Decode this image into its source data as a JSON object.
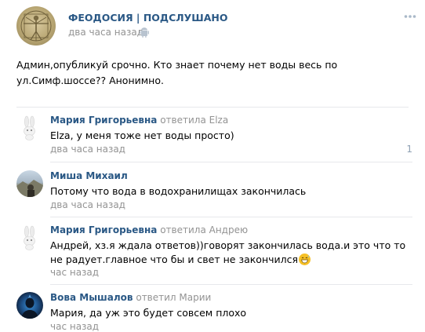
{
  "post": {
    "group_name": "ФЕОДОСИЯ | ПОДСЛУШАНО",
    "time": "два часа назад",
    "text": "Админ,опубликуй срочно. Кто знает почему нет воды весь по ул.Симф.шоссе?? Анонимно."
  },
  "comments": [
    {
      "author": "Мария Григорьевна",
      "reply_to": " ответила Elza",
      "text": "Elza, у меня тоже нет воды просто)",
      "time": "два часа назад",
      "likes": "1"
    },
    {
      "author": "Миша Михаил",
      "reply_to": "",
      "text": "Потому что вода в водохранилищах закончилась",
      "time": "два часа назад"
    },
    {
      "author": "Мария Григорьевна",
      "reply_to": " ответила Андрею",
      "text": "Андрей, хз.я ждала ответов))говорят закончилась вода.и это что то не радует.главное что бы и свет не закончился",
      "time": "час назад"
    },
    {
      "author": "Вова Мышалов",
      "reply_to": " ответил Марии",
      "text": "Мария, да уж это будет совсем плохо",
      "time": "час назад"
    }
  ],
  "icons": {
    "android": "android-icon",
    "more": "more-icon",
    "heart": "heart-icon",
    "emoji": "grinning-sweat-emoji-icon"
  },
  "colors": {
    "link": "#2a5885",
    "muted": "#939393",
    "divider": "#e7e8ec"
  }
}
